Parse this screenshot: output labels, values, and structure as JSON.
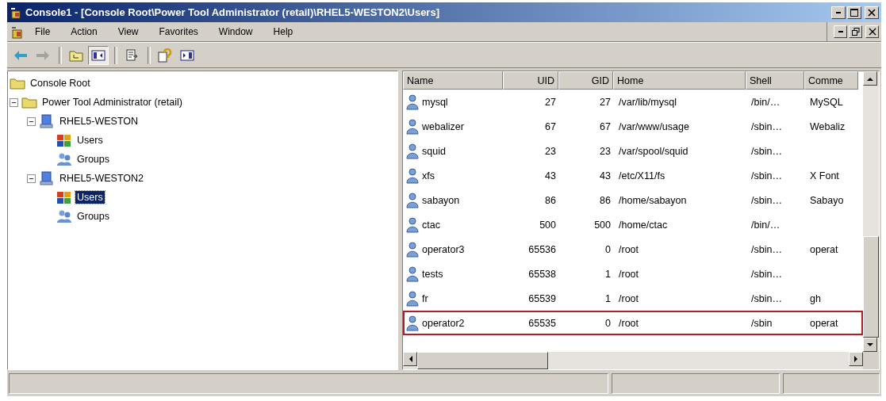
{
  "window": {
    "title": "Console1 - [Console Root\\Power Tool Administrator (retail)\\RHEL5-WESTON2\\Users]"
  },
  "menu": [
    {
      "label": "File"
    },
    {
      "label": "Action"
    },
    {
      "label": "View"
    },
    {
      "label": "Favorites"
    },
    {
      "label": "Window"
    },
    {
      "label": "Help"
    }
  ],
  "toolbar": [
    {
      "kind": "back",
      "disabled": false,
      "pressed": false
    },
    {
      "kind": "forward",
      "disabled": true,
      "pressed": false
    },
    {
      "kind": "separator"
    },
    {
      "kind": "up",
      "disabled": false,
      "pressed": false
    },
    {
      "kind": "tree",
      "disabled": false,
      "pressed": true
    },
    {
      "kind": "separator"
    },
    {
      "kind": "export",
      "disabled": false,
      "pressed": false
    },
    {
      "kind": "separator"
    },
    {
      "kind": "help",
      "disabled": false,
      "pressed": false
    },
    {
      "kind": "actionpane",
      "disabled": false,
      "pressed": false
    }
  ],
  "tree": [
    {
      "label": "Console Root",
      "kind": "folder",
      "selected": false,
      "children": [
        {
          "label": "Power Tool Administrator (retail)",
          "kind": "folder",
          "expanded": true,
          "selected": false,
          "children": [
            {
              "label": "RHEL5-WESTON",
              "kind": "computer",
              "expanded": true,
              "selected": false,
              "children": [
                {
                  "label": "Users",
                  "kind": "users",
                  "selected": false
                },
                {
                  "label": "Groups",
                  "kind": "groups",
                  "selected": false
                }
              ]
            },
            {
              "label": "RHEL5-WESTON2",
              "kind": "computer",
              "expanded": true,
              "selected": false,
              "children": [
                {
                  "label": "Users",
                  "kind": "users",
                  "selected": true
                },
                {
                  "label": "Groups",
                  "kind": "groups",
                  "selected": false
                }
              ]
            }
          ]
        }
      ]
    }
  ],
  "table": {
    "columns": [
      "Name",
      "UID",
      "GID",
      "Home",
      "Shell",
      "Comme"
    ],
    "rows": [
      {
        "cells": [
          "mysql",
          "27",
          "27",
          "/var/lib/mysql",
          "/bin/…",
          "MySQL"
        ],
        "highlighted": false
      },
      {
        "cells": [
          "webalizer",
          "67",
          "67",
          "/var/www/usage",
          "/sbin…",
          "Webaliz"
        ],
        "highlighted": false
      },
      {
        "cells": [
          "squid",
          "23",
          "23",
          "/var/spool/squid",
          "/sbin…",
          ""
        ],
        "highlighted": false
      },
      {
        "cells": [
          "xfs",
          "43",
          "43",
          "/etc/X11/fs",
          "/sbin…",
          "X Font"
        ],
        "highlighted": false
      },
      {
        "cells": [
          "sabayon",
          "86",
          "86",
          "/home/sabayon",
          "/sbin…",
          "Sabayo"
        ],
        "highlighted": false
      },
      {
        "cells": [
          "ctac",
          "500",
          "500",
          "/home/ctac",
          "/bin/…",
          ""
        ],
        "highlighted": false
      },
      {
        "cells": [
          "operator3",
          "65536",
          "0",
          "/root",
          "/sbin…",
          "operat"
        ],
        "highlighted": false
      },
      {
        "cells": [
          "tests",
          "65538",
          "1",
          "/root",
          "/sbin…",
          ""
        ],
        "highlighted": false
      },
      {
        "cells": [
          "fr",
          "65539",
          "1",
          "/root",
          "/sbin…",
          "gh"
        ],
        "highlighted": false
      },
      {
        "cells": [
          "operator2",
          "65535",
          "0",
          "/root",
          "/sbin",
          "operat"
        ],
        "highlighted": true
      }
    ]
  }
}
